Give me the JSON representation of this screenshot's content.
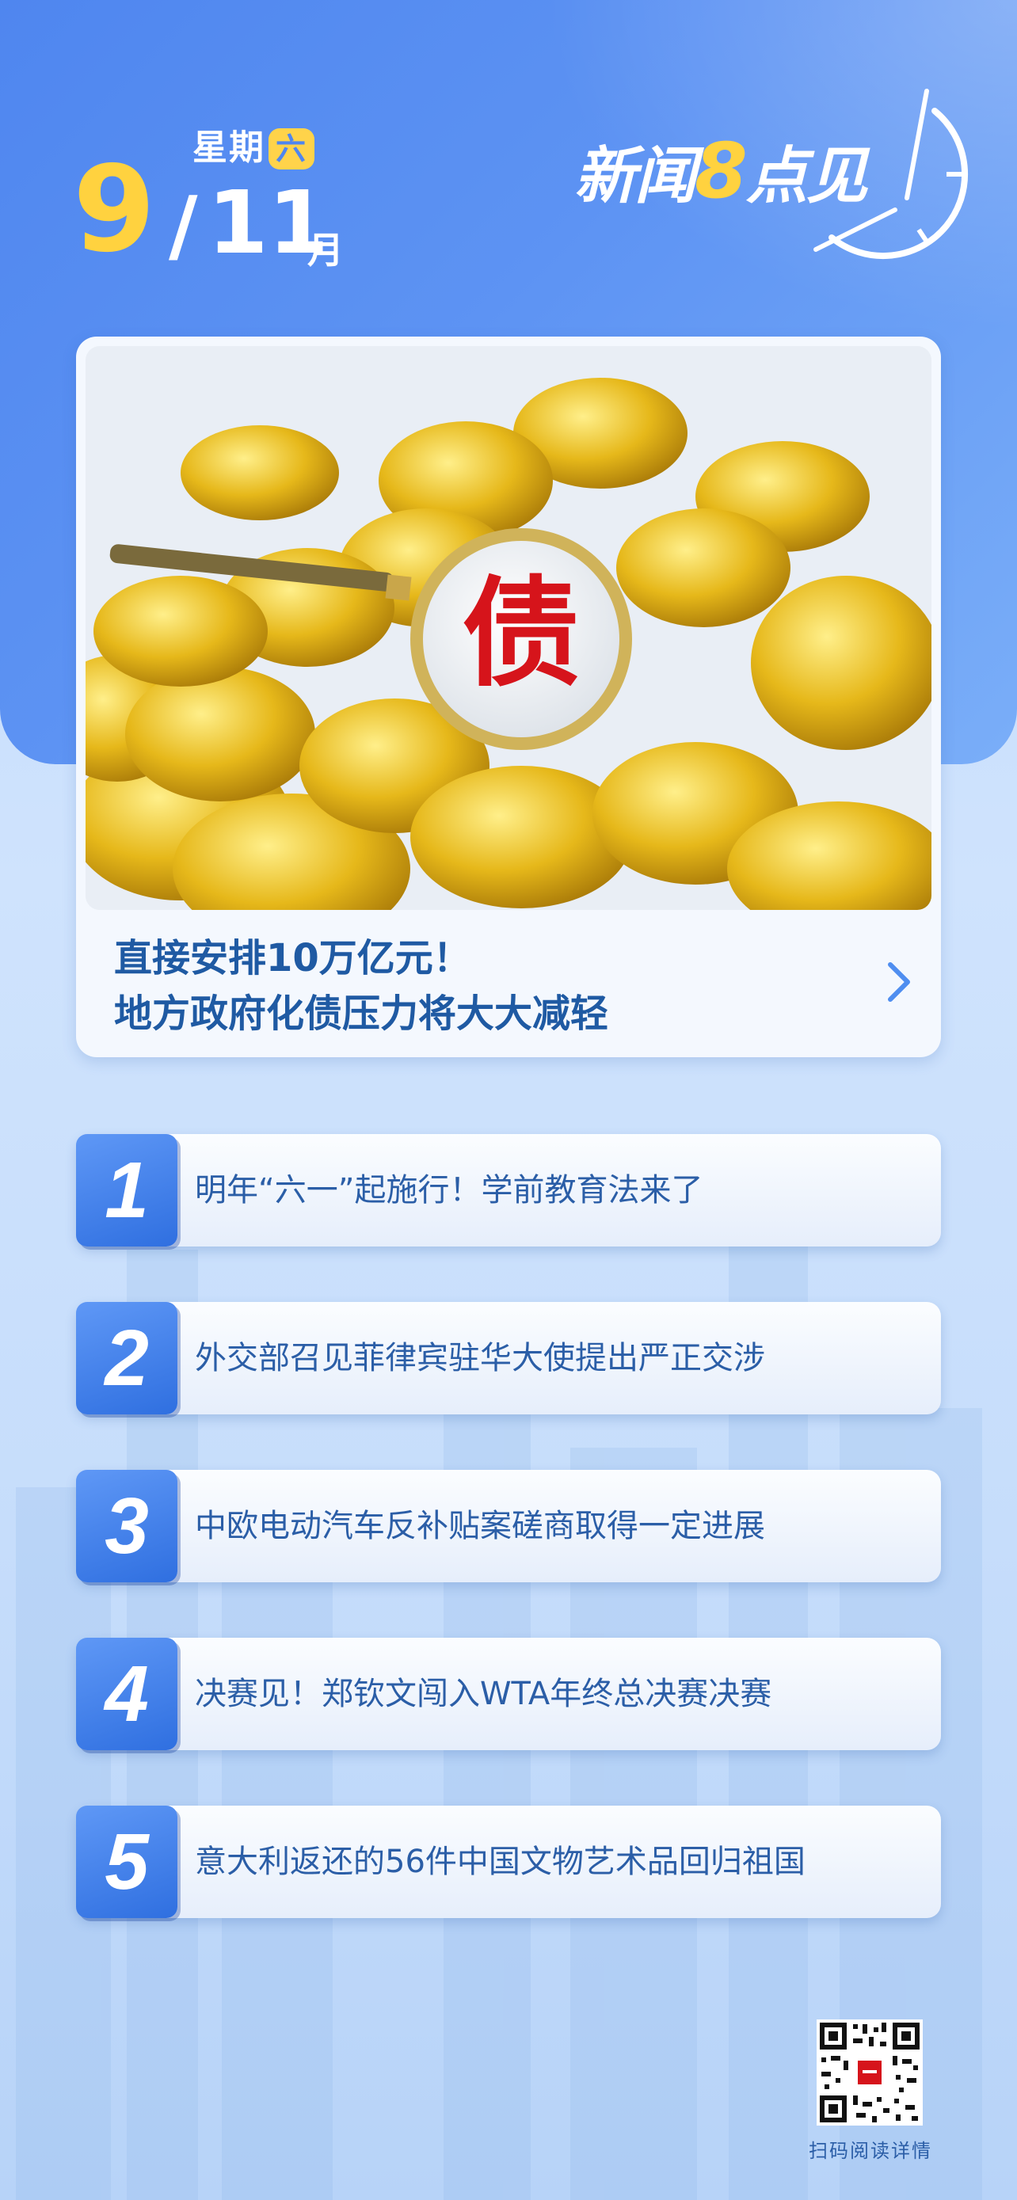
{
  "header": {
    "weekday_label": "星期",
    "weekday_day": "六",
    "day": "9",
    "slash": "/",
    "month": "11",
    "month_unit": "月",
    "brand": {
      "part1": "新闻",
      "eight": "8",
      "part2": "点见"
    }
  },
  "feature": {
    "image_text": "债",
    "title_line1": "直接安排10万亿元！",
    "title_line2": "地方政府化债压力将大大减轻"
  },
  "news": [
    {
      "num": "1",
      "text": "明年“六一”起施行！学前教育法来了"
    },
    {
      "num": "2",
      "text": "外交部召见菲律宾驻华大使提出严正交涉"
    },
    {
      "num": "3",
      "text": "中欧电动汽车反补贴案磋商取得一定进展"
    },
    {
      "num": "4",
      "text": "决赛见！郑钦文闯入WTA年终总决赛决赛"
    },
    {
      "num": "5",
      "text": "意大利返还的56件中国文物艺术品回归祖国"
    }
  ],
  "qr": {
    "caption": "扫码阅读详情"
  },
  "colors": {
    "accent_blue": "#4f86ef",
    "accent_yellow": "#ffd23f",
    "text_blue": "#2b5ea7"
  }
}
